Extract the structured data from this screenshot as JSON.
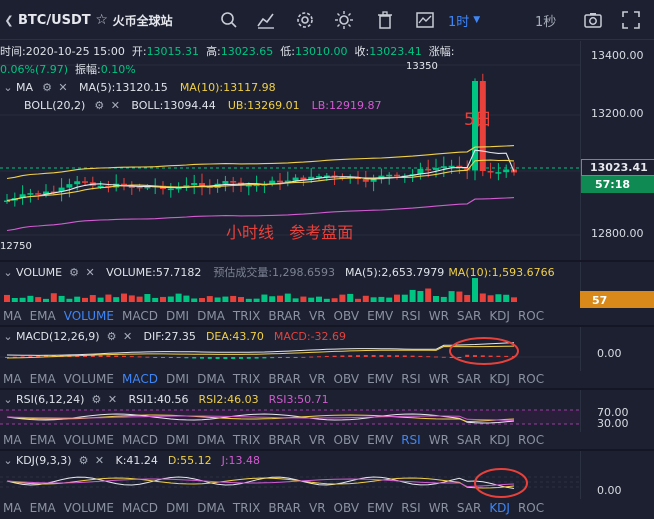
{
  "toolbar": {
    "pair": "BTC/USDT",
    "exchange": "火币全球站",
    "period": "1时",
    "second": "1秒",
    "icons": [
      "chevron-left-icon",
      "star-icon",
      "search-icon",
      "indicator-icon",
      "settings-icon",
      "theme-icon",
      "delete-icon",
      "chart-type-icon",
      "screenshot-icon",
      "fullscreen-icon"
    ]
  },
  "info": {
    "time_label": "时间:",
    "time": "2020-10-25 15:00",
    "open_label": "开:",
    "open": "13015.31",
    "high_label": "高:",
    "high": "13023.65",
    "low_label": "低:",
    "low": "13010.00",
    "close_label": "收:",
    "close": "13023.41",
    "change_label": "涨幅:",
    "change": "0.06%(7.97)",
    "amp_label": "振幅:",
    "amp": "0.10%"
  },
  "ma": {
    "name": "MA",
    "ma5": "MA(5):13120.15",
    "ma10": "MA(10):13117.98"
  },
  "boll": {
    "name": "BOLL(20,2)",
    "boll": "BOLL:13094.44",
    "ub": "UB:13269.01",
    "lb": "LB:12919.87"
  },
  "main_axis": {
    "labels": [
      "13400.00",
      "13200.00",
      "12800.00"
    ],
    "price_tag": "13023.41",
    "countdown": "57:18",
    "peak_label": "13350",
    "low_label": "12750"
  },
  "annotations": {
    "five_day": "5日",
    "hourly": "小时线   参考盘面"
  },
  "volume": {
    "name": "VOLUME",
    "value": "VOLUME:57.7182",
    "est": "预估成交量:1,298.6593",
    "ma5": "MA(5):2,653.7979",
    "ma10": "MA(10):1,593.6766",
    "tag": "57"
  },
  "macd": {
    "name": "MACD(12,26,9)",
    "dif": "DIF:27.35",
    "dea": "DEA:43.70",
    "macd": "MACD:-32.69",
    "axis": "0.00"
  },
  "rsi": {
    "name": "RSI(6,12,24)",
    "rsi1": "RSI1:40.56",
    "rsi2": "RSI2:46.03",
    "rsi3": "RSI3:50.71",
    "axis": [
      "70.00",
      "30.00"
    ]
  },
  "kdj": {
    "name": "KDJ(9,3,3)",
    "k": "K:41.24",
    "d": "D:55.12",
    "j": "J:13.48",
    "axis": "0.00"
  },
  "tabs": [
    "MA",
    "EMA",
    "VOLUME",
    "MACD",
    "DMI",
    "DMA",
    "TRIX",
    "BRAR",
    "VR",
    "OBV",
    "EMV",
    "RSI",
    "WR",
    "SAR",
    "KDJ",
    "ROC"
  ],
  "tab_rows": {
    "row1_active": "VOLUME",
    "row2_active": "MACD",
    "row3_active": "RSI",
    "row4_active": "KDJ"
  },
  "colors": {
    "up": "#00c582",
    "down": "#e8413b",
    "accent": "#3f86f7",
    "ma5": "#e6e8ee",
    "ma10": "#f1d047",
    "lb": "#d25cd1"
  }
}
